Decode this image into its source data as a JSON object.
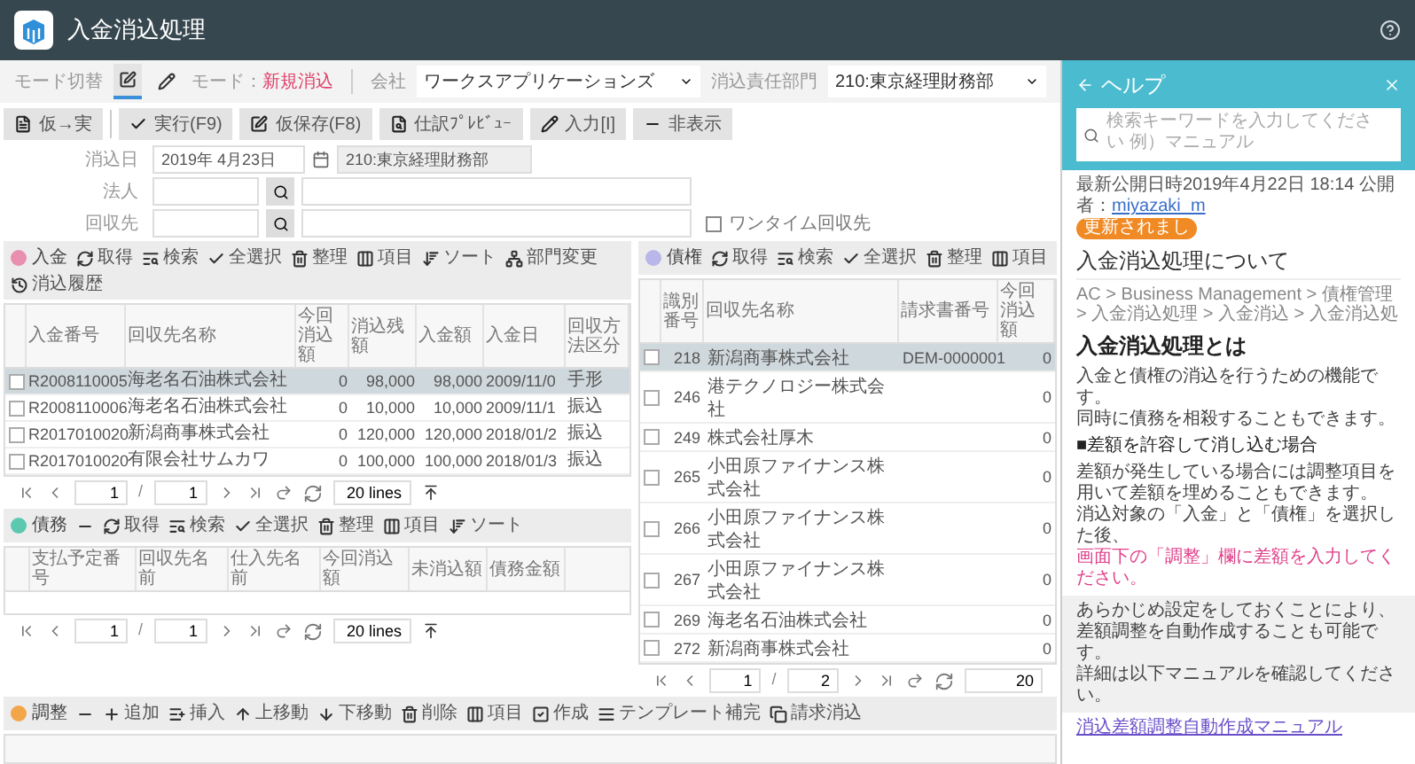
{
  "app": {
    "title": "入金消込処理"
  },
  "mode_bar": {
    "mode_label": "モード切替",
    "mode_prefix": "モード：",
    "mode_value": "新規消込",
    "company_label": "会社",
    "company": "ワークスアプリケーションズ",
    "dept_label": "消込責任部門",
    "dept": "210:東京経理財務部",
    "mode_buttons": [
      {
        "kind": "edit",
        "selected": true
      },
      {
        "kind": "pen",
        "selected": false
      }
    ]
  },
  "actions": [
    {
      "kind": "doc",
      "label": "仮→実"
    },
    {
      "kind": "check",
      "label": "実行(F9)"
    },
    {
      "kind": "edit",
      "label": "仮保存(F8)"
    },
    {
      "kind": "preview",
      "label": "仕訳ﾌﾟﾚﾋﾞｭｰ"
    },
    {
      "kind": "pen",
      "label": "入力[I]"
    },
    {
      "kind": "hide",
      "label": "非表示"
    }
  ],
  "form": {
    "date_label": "消込日",
    "date": "2019年 4月23日",
    "date_dept": "210:東京経理財務部",
    "corp_label": "法人",
    "payer_label": "回収先",
    "onetime": {
      "label": "ワンタイム回収先",
      "checked": false
    }
  },
  "receipts": {
    "toolbar": [
      {
        "kind": "dot",
        "label": "入金",
        "color": "#e88fb0"
      },
      {
        "kind": "refresh",
        "label": "取得"
      },
      {
        "kind": "search",
        "label": "検索"
      },
      {
        "kind": "selectall",
        "label": "全選択"
      },
      {
        "kind": "trash",
        "label": "整理"
      },
      {
        "kind": "columns",
        "label": "項目"
      },
      {
        "kind": "sort",
        "label": "ソート"
      },
      {
        "kind": "org",
        "label": "部門変更"
      },
      {
        "kind": "history",
        "label": "消込履歴"
      }
    ],
    "columns": [
      "入金番号",
      "回収先名称",
      "今回消込額",
      "消込残額",
      "入金額",
      "入金日",
      "回収方法区分"
    ],
    "rows": [
      {
        "cells": [
          "R2008110005",
          "海老名石油株式会社",
          "0",
          "98,000",
          "98,000",
          "2009/11/0",
          "手形"
        ],
        "selected": true,
        "checked": false
      },
      {
        "cells": [
          "R2008110006",
          "海老名石油株式会社",
          "0",
          "10,000",
          "10,000",
          "2009/11/1",
          "振込"
        ],
        "selected": false,
        "checked": false
      },
      {
        "cells": [
          "R2017010020",
          "新潟商事株式会社",
          "0",
          "120,000",
          "120,000",
          "2018/01/2",
          "振込"
        ],
        "selected": false,
        "checked": false
      },
      {
        "cells": [
          "R2017010020",
          "有限会社サムカワ",
          "0",
          "100,000",
          "100,000",
          "2018/01/3",
          "振込"
        ],
        "selected": false,
        "checked": false
      }
    ],
    "pager": {
      "page": "1",
      "sep": "/",
      "pages": "1",
      "lines": "20 lines"
    }
  },
  "claims": {
    "toolbar": [
      {
        "kind": "dot",
        "label": "債権",
        "color": "#b9b6ea"
      },
      {
        "kind": "refresh",
        "label": "取得"
      },
      {
        "kind": "search",
        "label": "検索"
      },
      {
        "kind": "selectall",
        "label": "全選択"
      },
      {
        "kind": "trash",
        "label": "整理"
      },
      {
        "kind": "columns",
        "label": "項目"
      }
    ],
    "columns": [
      "識別番号",
      "回収先名称",
      "請求書番号",
      "今回消込額"
    ],
    "rows": [
      {
        "id": "218",
        "name": "新潟商事株式会社",
        "invoice": "DEM-0000001",
        "amount": "0",
        "selected": true,
        "checked": false
      },
      {
        "id": "246",
        "name": "港テクノロジー株式会社",
        "amount": "0",
        "selected": false,
        "checked": false
      },
      {
        "id": "249",
        "name": "株式会社厚木",
        "amount": "0",
        "selected": false,
        "checked": false
      },
      {
        "id": "265",
        "name": "小田原ファイナンス株式会社",
        "amount": "0",
        "selected": false,
        "checked": false
      },
      {
        "id": "266",
        "name": "小田原ファイナンス株式会社",
        "amount": "0",
        "selected": false,
        "checked": false
      },
      {
        "id": "267",
        "name": "小田原ファイナンス株式会社",
        "amount": "0",
        "selected": false,
        "checked": false
      },
      {
        "id": "269",
        "name": "海老名石油株式会社",
        "amount": "0",
        "selected": false,
        "checked": false
      },
      {
        "id": "272",
        "name": "新潟商事株式会社",
        "amount": "0",
        "selected": false,
        "checked": false
      }
    ],
    "pager": {
      "page": "1",
      "sep": "/",
      "pages": "2",
      "lines": "20"
    }
  },
  "payables": {
    "toolbar": [
      {
        "kind": "dot",
        "label": "債務",
        "color": "#5cc8b0"
      },
      {
        "kind": "minus"
      },
      {
        "kind": "refresh",
        "label": "取得"
      },
      {
        "kind": "search",
        "label": "検索"
      },
      {
        "kind": "selectall",
        "label": "全選択"
      },
      {
        "kind": "trash",
        "label": "整理"
      },
      {
        "kind": "columns",
        "label": "項目"
      },
      {
        "kind": "sort",
        "label": "ソート"
      }
    ],
    "columns": [
      "支払予定番号",
      "回収先名前",
      "仕入先名前",
      "今回消込額",
      "未消込額",
      "債務金額"
    ],
    "pager": {
      "page": "1",
      "sep": "/",
      "pages": "1",
      "lines": "20 lines"
    }
  },
  "adjust": {
    "toolbar": [
      {
        "kind": "dot",
        "label": "調整",
        "color": "#f3a54a"
      },
      {
        "kind": "minus"
      },
      {
        "kind": "plus",
        "label": "追加"
      },
      {
        "kind": "insert",
        "label": "挿入"
      },
      {
        "kind": "up",
        "label": "上移動"
      },
      {
        "kind": "down",
        "label": "下移動"
      },
      {
        "kind": "trash",
        "label": "削除"
      },
      {
        "kind": "columns",
        "label": "項目"
      },
      {
        "kind": "check",
        "label": "作成"
      },
      {
        "kind": "template",
        "label": "テンプレート補完"
      },
      {
        "kind": "copy",
        "label": "請求消込"
      }
    ]
  },
  "help": {
    "title": "ヘルプ",
    "search_placeholder": "検索キーワードを入力してください 例）マニュアル",
    "meta": "最新公開日時2019年4月22日 18:14 公開者：",
    "author": "miyazaki_m",
    "badge": "更新されまし",
    "heading": "入金消込処理について",
    "breadcrumb": "AC > Business Management > 債権管理 > 入金消込処理 > 入金消込 > 入金消込処",
    "section": "入金消込処理とは",
    "blocks": [
      {
        "kind": "text",
        "lines": [
          "入金と債権の消込を行うための機能です。",
          "同時に債務を相殺することもできます。"
        ]
      },
      {
        "kind": "subheading",
        "lines": [
          "■差額を許容して消し込む場合"
        ]
      },
      {
        "kind": "text",
        "lines": [
          "差額が発生している場合には調整項目を用いて差額を埋めることもできます。",
          "消込対象の「入金」と「債権」を選択した後、"
        ]
      },
      {
        "kind": "emphasis",
        "lines": [
          "画面下の「調整」欄に差額を入力してください。"
        ]
      },
      {
        "kind": "note",
        "lines": [
          "あらかじめ設定をしておくことにより、",
          "差額調整を自動作成することも可能です。",
          "詳細は以下マニュアルを確認してください。"
        ]
      },
      {
        "kind": "link",
        "lines": [
          "消込差額調整自動作成マニュアル"
        ]
      }
    ]
  }
}
